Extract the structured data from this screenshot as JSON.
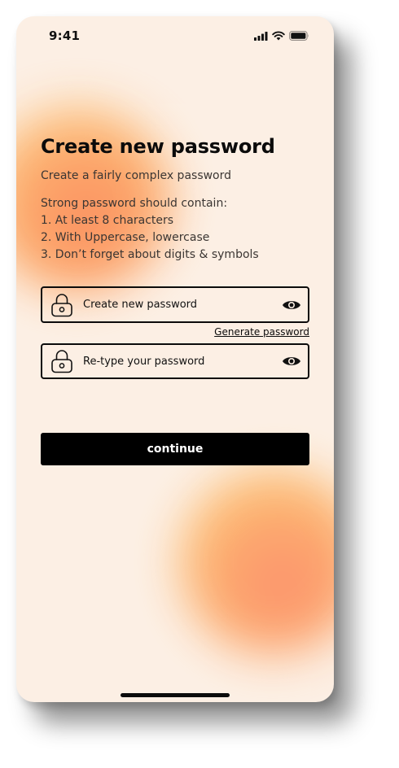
{
  "status_bar": {
    "time": "9:41"
  },
  "screen": {
    "title": "Create new password",
    "subtitle": "Create a fairly complex password",
    "rules": [
      "Strong password should contain:",
      "1. At least 8 characters",
      "2. With Uppercase, lowercase",
      "3. Don’t forget about digits & symbols"
    ]
  },
  "form": {
    "new_password": {
      "placeholder": "Create new password",
      "value": ""
    },
    "generate_label": "Generate password",
    "retype_password": {
      "placeholder": "Re-type your password",
      "value": ""
    },
    "continue_label": "continue"
  },
  "icons": {
    "signal": "cellular-signal-icon",
    "wifi": "wifi-icon",
    "battery": "battery-icon",
    "lock": "lock-icon",
    "eye": "eye-icon"
  },
  "colors": {
    "background": "#fcefe4",
    "text": "#0b0b0b",
    "button": "#000000",
    "button_text": "#ffffff",
    "blob_orange": "#fca263",
    "blob_coral": "#fb8a5c"
  }
}
